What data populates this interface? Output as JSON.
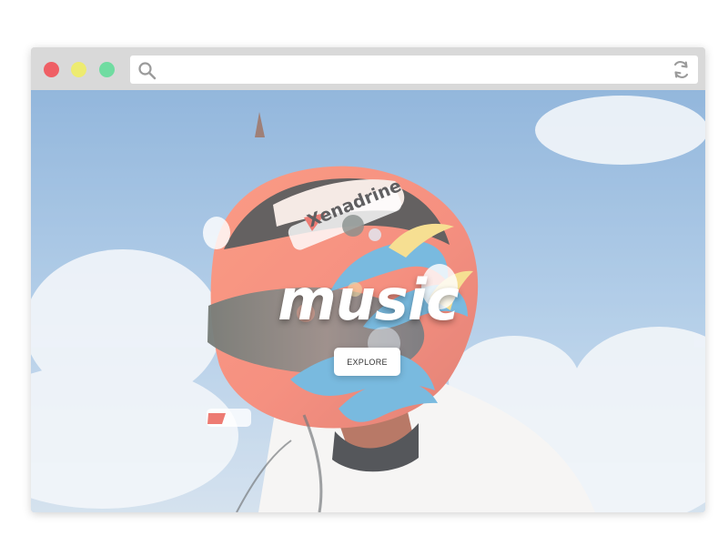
{
  "browser": {
    "controls": {
      "close_color": "#ef5f65",
      "minimize_color": "#edeb70",
      "maximize_color": "#70dca1"
    },
    "toolbar": {
      "address_value": "",
      "address_placeholder": "",
      "search_icon": "search-icon",
      "refresh_icon": "refresh-icon"
    }
  },
  "hero": {
    "title": "music",
    "button_label": "EXPLORE",
    "background_image": "helmet-portrait",
    "helmet_text": "Xenadrine"
  }
}
